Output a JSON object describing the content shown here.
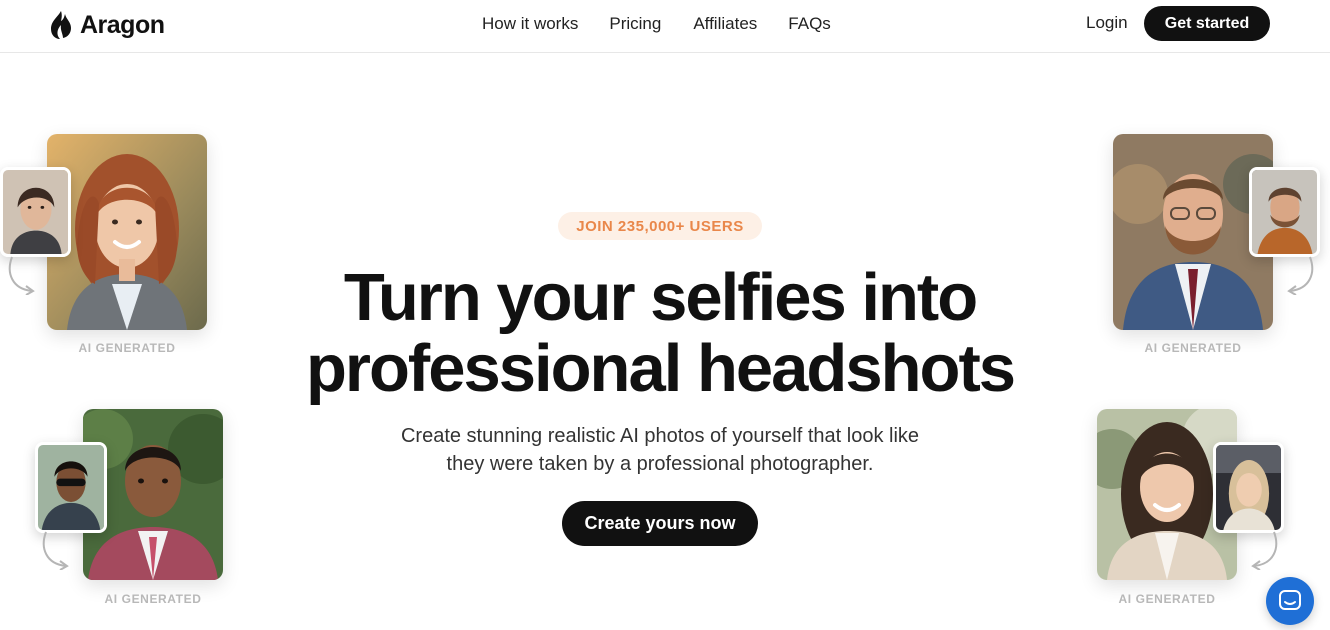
{
  "brand": {
    "name": "Aragon"
  },
  "nav": {
    "links": [
      "How it works",
      "Pricing",
      "Affiliates",
      "FAQs"
    ],
    "login": "Login",
    "get_started": "Get started"
  },
  "hero": {
    "badge": "JOIN 235,000+ USERS",
    "headline_line1": "Turn your selfies into",
    "headline_line2": "professional headshots",
    "subtext_line1": "Create stunning realistic AI photos of yourself that look like",
    "subtext_line2": "they were taken by a professional photographer.",
    "cta": "Create yours now"
  },
  "photo_label": "AI GENERATED",
  "colors": {
    "primary": "#111111",
    "badge_bg": "#fdf0e6",
    "badge_text": "#e9874a",
    "chat": "#1f6fd6",
    "label": "#b8b8b8"
  },
  "icons": [
    "aragon-flame-icon",
    "curved-arrow-icon",
    "chat-bubble-icon"
  ]
}
